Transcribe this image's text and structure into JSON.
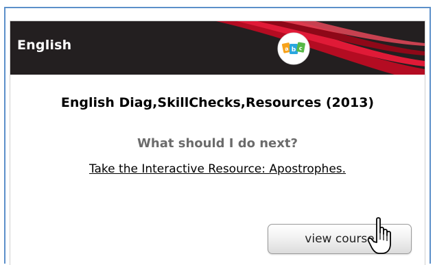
{
  "banner": {
    "title": "English",
    "logo_icon": "abc-blocks-icon",
    "background_color": "#231f20",
    "accent_color": "#c8102e"
  },
  "course": {
    "title": "English Diag,SkillChecks,Resources (2013)"
  },
  "next_step": {
    "question": "What should I do next?",
    "link_text": "Take the Interactive Resource: Apostrophes."
  },
  "actions": {
    "view_course_label": "view course"
  },
  "cursor": {
    "icon": "hand-pointer-icon"
  }
}
